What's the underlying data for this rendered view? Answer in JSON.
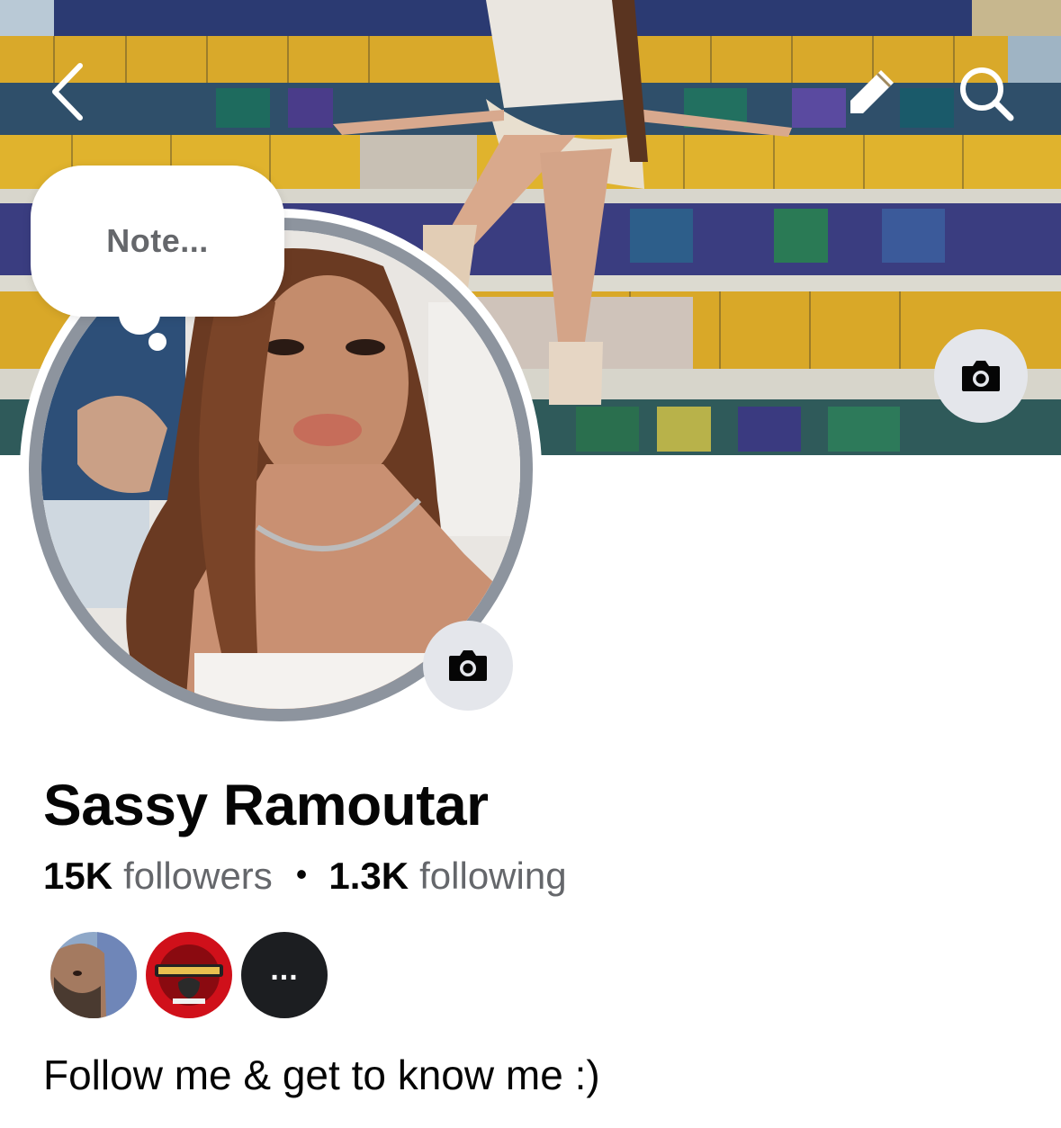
{
  "colors": {
    "primary_text": "#050505",
    "secondary_text": "#65676b",
    "icon_button_bg": "#e4e6eb",
    "avatar_ring": "#8d949e"
  },
  "header": {
    "back_icon": "chevron-left-icon",
    "edit_icon": "pencil-icon",
    "search_icon": "search-icon"
  },
  "cover": {
    "camera_icon": "camera-icon"
  },
  "note": {
    "placeholder": "Note..."
  },
  "profile": {
    "name": "Sassy Ramoutar",
    "followers_count": "15K",
    "followers_label": "followers",
    "separator": "•",
    "following_count": "1.3K",
    "following_label": "following",
    "bio": "Follow me & get to know me :)"
  },
  "mutual_followers": {
    "more_label": "..."
  }
}
